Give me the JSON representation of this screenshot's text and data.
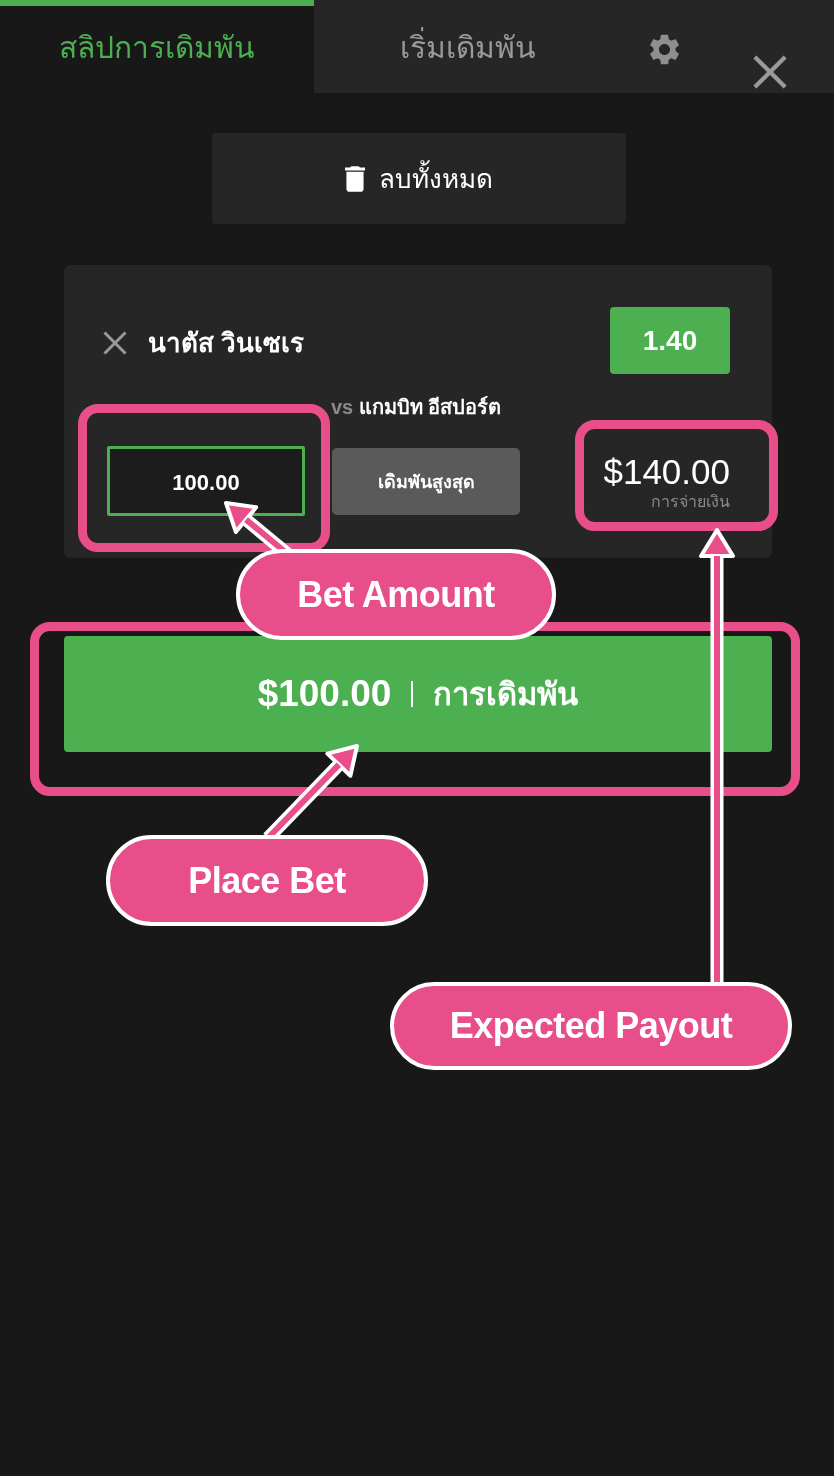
{
  "tabs": [
    {
      "label": "สลิปการเดิมพัน",
      "selected": true
    },
    {
      "label": "เริ่มเดิมพัน",
      "selected": false
    }
  ],
  "clear_all_button": {
    "label": "ลบทั้งหมด"
  },
  "bet_slip": [
    {
      "selection": "นาตัส วินเซเร",
      "market": "vs **แกมบิท อีสปอร์ต**",
      "odds": "1.40",
      "stake": "100.00",
      "stake_focused": true,
      "max_bet_label": "เดิมพันสูงสุด",
      "payout": "$140.00",
      "payout_label": "การจ่ายเงิน"
    }
  ],
  "place_bet_button": {
    "amount": "$100.00",
    "label": "การเดิมพัน"
  },
  "annotations": [
    {
      "label": "Bet Amount"
    },
    {
      "label": "Place Bet"
    },
    {
      "label": "Expected Payout"
    }
  ]
}
